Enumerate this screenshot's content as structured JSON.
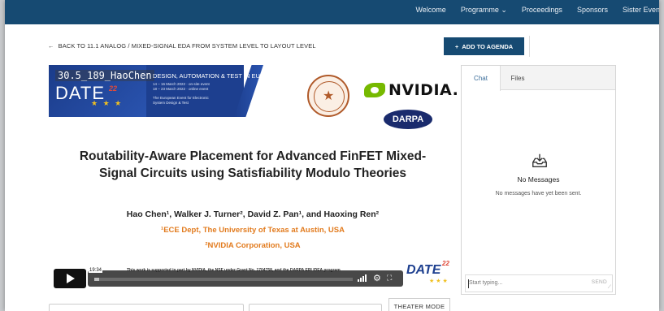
{
  "nav": {
    "items": [
      "Welcome",
      "Programme ⌄",
      "Proceedings",
      "Sponsors",
      "Sister Events"
    ]
  },
  "back_link": "BACK TO 11.1 ANALOG / MIXED-SIGNAL EDA FROM SYSTEM LEVEL TO LAYOUT LEVEL",
  "agenda_button": "ADD TO AGENDA",
  "slide": {
    "watermark": "30.5_189_HaoChen",
    "date_word": "DATE",
    "date_superscript": "22",
    "banner_title": "DESIGN, AUTOMATION & TEST IN EUROPE",
    "banner_line1": "14 – 16 March 2022 · on-site event",
    "banner_line2": "18 – 23 March 2022 · online event",
    "banner_line3": "The European Event for Electronic",
    "banner_line4": "System Design & Test",
    "nvidia": "NVIDIA.",
    "darpa": "DARPA",
    "title_line1": "Routability-Aware Placement for Advanced FinFET Mixed-",
    "title_line2": "Signal Circuits using Satisfiability Modulo Theories",
    "authors": "Hao Chen¹, Walker J. Turner², David Z. Pan¹, and Haoxing Ren²",
    "affiliation1": "¹ECE Dept, The University of Texas at Austin, USA",
    "affiliation2": "²NVIDIA Corporation, USA",
    "support_note": "This work is supported in part by NVIDIA, the NSF under Grant No. 1704758, and the DARPA ERI IDEA program",
    "date_logo": "DATE",
    "date_logo_22": "22"
  },
  "player": {
    "time": "19:34",
    "progress_fraction": 0.02
  },
  "theater_button": "THEATER MODE",
  "chat": {
    "tab_chat": "Chat",
    "tab_files": "Files",
    "empty_title": "No Messages",
    "empty_subtitle": "No messages have yet been sent.",
    "input_placeholder": "Start typing...",
    "send_label": "SEND"
  },
  "colors": {
    "nav_bg": "#164a72",
    "accent_orange": "#e27b1e",
    "nvidia_green": "#76b900"
  }
}
